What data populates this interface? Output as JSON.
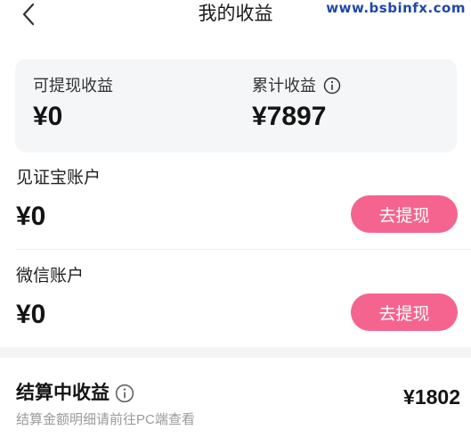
{
  "header": {
    "title": "我的收益"
  },
  "watermark": "www.bsbinfx.com",
  "summary": {
    "withdrawable": {
      "label": "可提现收益",
      "value": "¥0"
    },
    "cumulative": {
      "label": "累计收益",
      "value": "¥7897"
    }
  },
  "accounts": [
    {
      "name": "见证宝账户",
      "amount": "¥0",
      "button": "去提现"
    },
    {
      "name": "微信账户",
      "amount": "¥0",
      "button": "去提现"
    }
  ],
  "settlement": {
    "title": "结算中收益",
    "amount": "¥1802",
    "note": "结算金额明细请前往PC端查看"
  },
  "colors": {
    "accent": "#f5648f",
    "card_bg": "#f5f6f8",
    "watermark": "#1f49a8"
  }
}
